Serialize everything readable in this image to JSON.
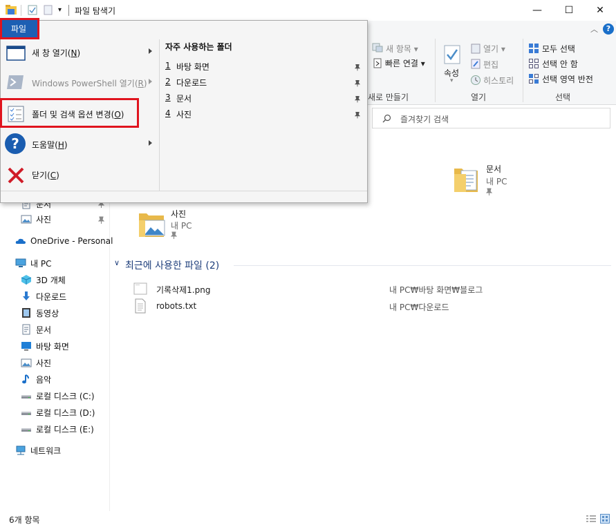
{
  "window": {
    "title": "파일 탐색기",
    "minimize": "—",
    "maximize": "☐",
    "close": "✕"
  },
  "ribbon": {
    "new_item": "새 항목",
    "easy_access": "빠른 연결",
    "new_group": "새로 만들기",
    "properties": "속성",
    "open": "열기",
    "edit": "편집",
    "history": "히스토리",
    "open_group": "열기",
    "select_all": "모두 선택",
    "select_none": "선택 안 함",
    "invert_selection": "선택 영역 반전",
    "select_group": "선택"
  },
  "search": {
    "placeholder": "즐겨찾기 검색"
  },
  "file_menu": {
    "tab_label": "파일",
    "items": [
      {
        "label": "새 창 열기(",
        "key": "N",
        "suffix": ")"
      },
      {
        "label": "Windows PowerShell 열기(",
        "key": "R",
        "suffix": ")"
      },
      {
        "label": "폴더 및 검색 옵션 변경(",
        "key": "O",
        "suffix": ")"
      },
      {
        "label": "도움말(",
        "key": "H",
        "suffix": ")"
      },
      {
        "label": "닫기(",
        "key": "C",
        "suffix": ")"
      }
    ],
    "frequent_title": "자주 사용하는 폴더",
    "frequent": [
      {
        "num": "1",
        "name": "바탕 화면"
      },
      {
        "num": "2",
        "name": "다운로드"
      },
      {
        "num": "3",
        "name": "문서"
      },
      {
        "num": "4",
        "name": "사진"
      }
    ]
  },
  "nav": {
    "quick": [
      {
        "label": "문서"
      },
      {
        "label": "사진"
      }
    ],
    "onedrive": "OneDrive - Personal",
    "this_pc": "내 PC",
    "pc_items": [
      {
        "label": "3D 개체",
        "icon": "3d-objects-icon"
      },
      {
        "label": "다운로드",
        "icon": "download-icon"
      },
      {
        "label": "동영상",
        "icon": "video-icon"
      },
      {
        "label": "문서",
        "icon": "document-icon"
      },
      {
        "label": "바탕 화면",
        "icon": "desktop-icon"
      },
      {
        "label": "사진",
        "icon": "pictures-icon"
      },
      {
        "label": "음악",
        "icon": "music-icon"
      },
      {
        "label": "로컬 디스크 (C:)",
        "icon": "drive-icon"
      },
      {
        "label": "로컬 디스크 (D:)",
        "icon": "drive-icon"
      },
      {
        "label": "로컬 디스크 (E:)",
        "icon": "drive-icon"
      }
    ],
    "network": "네트워크"
  },
  "content": {
    "folders": [
      {
        "name": "문서",
        "location": "내 PC"
      },
      {
        "name": "사진",
        "location": "내 PC"
      }
    ],
    "recent_header": "최근에 사용한 파일 (2)",
    "recent": [
      {
        "name": "기록삭제1.png",
        "path": "내 PC₩바탕 화면₩블로그"
      },
      {
        "name": "robots.txt",
        "path": "내 PC₩다운로드"
      }
    ]
  },
  "status": {
    "count": "6개 항목"
  },
  "colors": {
    "accent": "#0063b1",
    "highlight_box": "#e0141e",
    "folder": "#e8b94a"
  }
}
